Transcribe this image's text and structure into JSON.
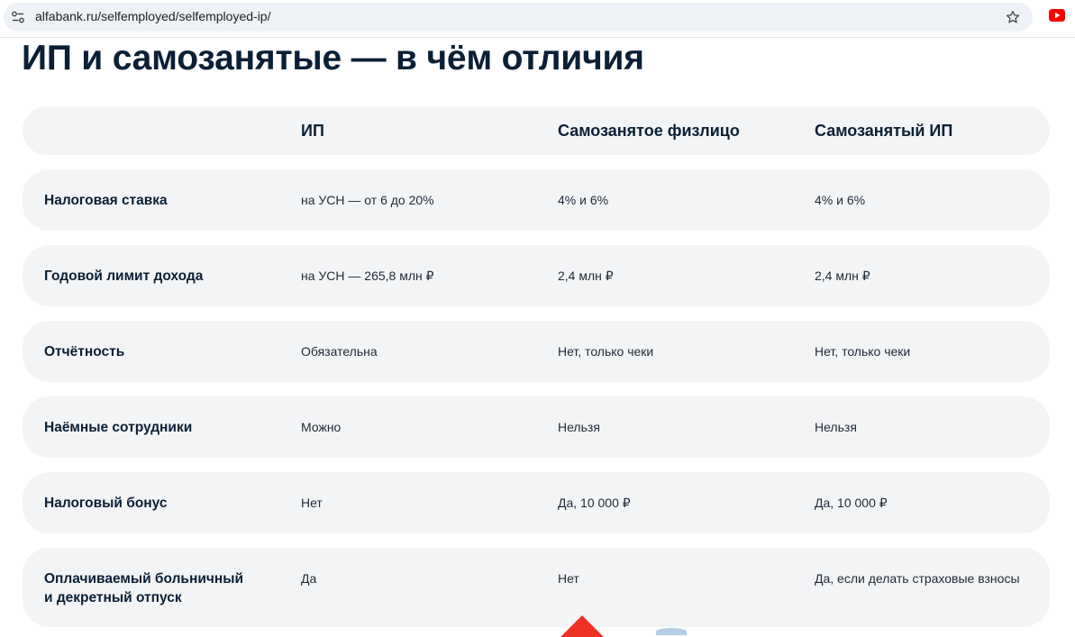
{
  "browser": {
    "url": "alfabank.ru/selfemployed/selfemployed-ip/",
    "icons": [
      "site-info-icon",
      "bookmark-star-icon",
      "youtube-ext-icon"
    ],
    "accent_colors": {
      "youtube": "#ff0000"
    }
  },
  "page": {
    "title": "ИП и самозанятые — в чём отличия"
  },
  "table": {
    "headers": [
      "",
      "ИП",
      "Самозанятое физлицо",
      "Самозанятый ИП"
    ],
    "rows": [
      {
        "label": "Налоговая ставка",
        "values": [
          "на УСН — от 6 до 20%",
          "4% и 6%",
          "4% и 6%"
        ]
      },
      {
        "label": "Годовой лимит дохода",
        "values": [
          "на УСН — 265,8 млн ₽",
          "2,4 млн ₽",
          "2,4 млн ₽"
        ]
      },
      {
        "label": "Отчётность",
        "values": [
          "Обязательна",
          "Нет, только чеки",
          "Нет, только чеки"
        ]
      },
      {
        "label": "Наёмные сотрудники",
        "values": [
          "Можно",
          "Нельзя",
          "Нельзя"
        ]
      },
      {
        "label": "Налоговый бонус",
        "values": [
          "Нет",
          "Да, 10 000 ₽",
          "Да, 10 000 ₽"
        ]
      },
      {
        "label_line1": "Оплачиваемый больничный",
        "label_line2": "и декретный отпуск",
        "values": [
          "Да",
          "Нет",
          "Да, если делать страховые взносы"
        ]
      }
    ]
  },
  "colors": {
    "row_background": "#f3f4f5",
    "text": "#0b1f35",
    "brand_red": "#ef3124"
  }
}
